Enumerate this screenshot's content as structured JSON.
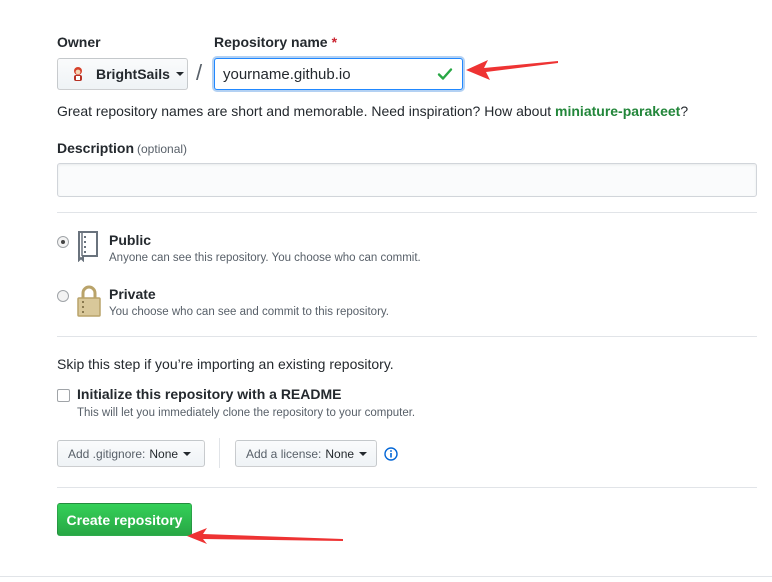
{
  "owner": {
    "label": "Owner",
    "name": "BrightSails"
  },
  "repo": {
    "label": "Repository name",
    "required_mark": "*",
    "value": "yourname.github.io"
  },
  "separator": "/",
  "hint": {
    "prefix": "Great repository names are short and memorable. Need inspiration? How about ",
    "suggestion": "miniature-parakeet",
    "suffix": "?"
  },
  "description": {
    "label": "Description",
    "optional": "(optional)",
    "value": ""
  },
  "visibility": {
    "public": {
      "title": "Public",
      "note": "Anyone can see this repository. You choose who can commit.",
      "checked": true
    },
    "private": {
      "title": "Private",
      "note": "You choose who can see and commit to this repository.",
      "checked": false
    }
  },
  "skip_text": "Skip this step if you’re importing an existing repository.",
  "readme": {
    "title": "Initialize this repository with a README",
    "note": "This will let you immediately clone the repository to your computer.",
    "checked": false
  },
  "gitignore": {
    "label": "Add .gitignore:",
    "value": "None"
  },
  "license": {
    "label": "Add a license:",
    "value": "None"
  },
  "create_button": "Create repository",
  "colors": {
    "accent": "#2188ff",
    "success": "#28a745",
    "annotation": "#ee3333"
  },
  "icons": [
    "owner-avatar-icon",
    "caret-down-icon",
    "check-icon",
    "repo-book-icon",
    "lock-icon",
    "info-icon",
    "arrow-annotation"
  ]
}
